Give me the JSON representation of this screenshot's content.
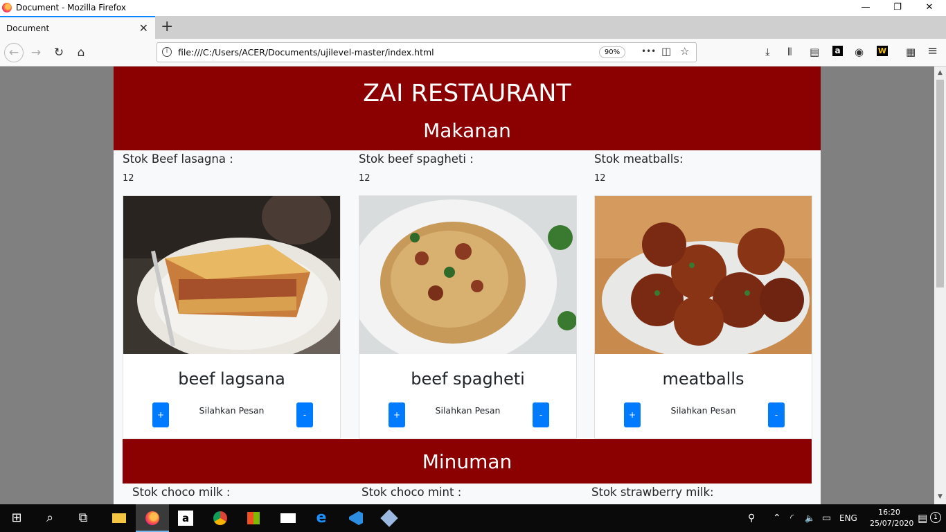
{
  "window": {
    "title": "Document - Mozilla Firefox",
    "minimize_glyph": "—",
    "restore_glyph": "❐",
    "close_glyph": "✕"
  },
  "tabs": [
    {
      "label": "Document",
      "close_glyph": "✕"
    }
  ],
  "newtab_glyph": "+",
  "nav": {
    "back_glyph": "←",
    "forward_glyph": "→",
    "reload_glyph": "↻",
    "home_glyph": "⌂",
    "url": "file:///C:/Users/ACER/Documents/ujilevel-master/index.html",
    "zoom": "90%",
    "info_glyph": "i",
    "more_glyph": "•••",
    "pocket_glyph": "◫",
    "bookmark_glyph": "☆",
    "toolbar_icons": [
      "download-icon",
      "library-icon",
      "sidebar-icon",
      "amazon-icon",
      "account-icon",
      "extension-icon",
      "extensions-icon",
      "menu-icon"
    ],
    "download_glyph": "⤓",
    "library_glyph": "⦀",
    "sidebar_glyph": "▤",
    "amazon_glyph": "a",
    "account_glyph": "◉",
    "extension_glyph": "W",
    "addons_glyph": "▦",
    "menu_glyph": "≡"
  },
  "page": {
    "restaurant_name": "ZAI RESTAURANT",
    "food_section": "Makanan",
    "drink_section": "Minuman",
    "order_label": "Silahkan Pesan",
    "plus_label": "+",
    "minus_label": "-",
    "foods": [
      {
        "stock_label": "Stok Beef lasagna :",
        "stock_value": "12",
        "name": "beef lagsana"
      },
      {
        "stock_label": "Stok beef spagheti :",
        "stock_value": "12",
        "name": "beef spagheti"
      },
      {
        "stock_label": "Stok meatballs:",
        "stock_value": "12",
        "name": "meatballs"
      }
    ],
    "drinks": [
      {
        "stock_label": "Stok choco milk :"
      },
      {
        "stock_label": "Stok choco mint :"
      },
      {
        "stock_label": "Stok strawberry milk:"
      }
    ],
    "colors": {
      "header_bg": "#8b0000",
      "button_bg": "#007bff",
      "page_bg": "#f8f9fa"
    }
  },
  "taskbar": {
    "start_glyph": "⊞",
    "search_glyph": "⌕",
    "taskview_glyph": "⧉",
    "apps": [
      "file-explorer-icon",
      "firefox-icon",
      "amazon-icon",
      "chrome-icon",
      "store-icon",
      "mail-icon",
      "edge-icon",
      "vscode-icon",
      "virtualbox-icon"
    ],
    "tray_people_glyph": "⚲",
    "tray_chevron_glyph": "⌃",
    "tray_network_glyph": "◜",
    "tray_volume_glyph": "🔈",
    "tray_battery_glyph": "▭",
    "language": "ENG",
    "time": "16:20",
    "date": "25/07/2020",
    "notification_glyph": "▤",
    "notification_count": "1"
  }
}
